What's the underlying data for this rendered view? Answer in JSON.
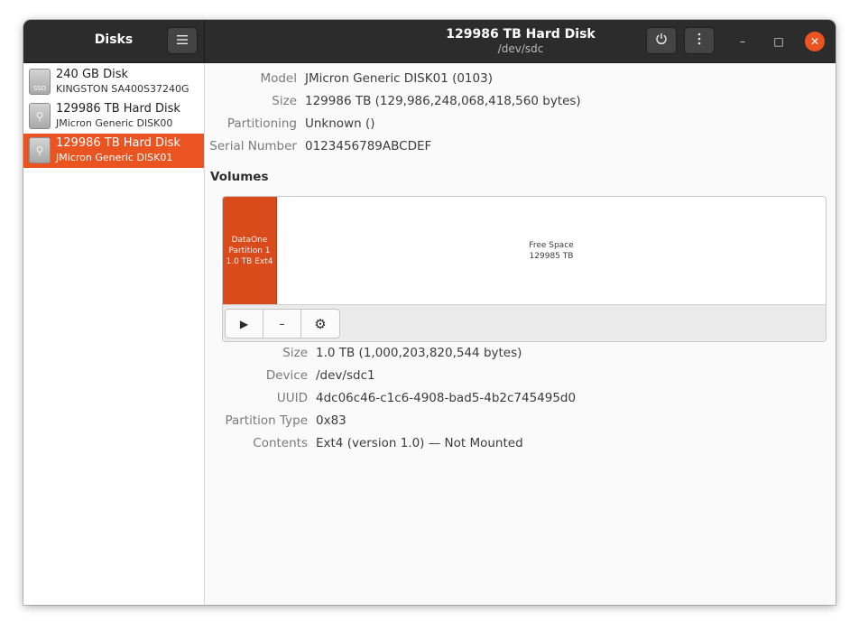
{
  "app": {
    "title": "Disks",
    "menu_icon": "hamburger-menu-icon"
  },
  "window": {
    "title": "129986 TB Hard Disk",
    "subtitle": "/dev/sdc",
    "power_icon": "power-icon",
    "more_icon": "vertical-dots-icon",
    "minimize_glyph": "–",
    "maximize_glyph": "□",
    "close_glyph": "✕"
  },
  "disks": [
    {
      "name": "240 GB Disk",
      "model": "KINGSTON SA400S37240G",
      "icon": "ssd-icon",
      "icon_text": "SSD",
      "selected": false
    },
    {
      "name": "129986 TB Hard Disk",
      "model": "JMicron Generic DISK00",
      "icon": "usb-drive-icon",
      "icon_text": "⚲",
      "selected": false
    },
    {
      "name": "129986 TB Hard Disk",
      "model": "JMicron Generic DISK01",
      "icon": "usb-drive-icon",
      "icon_text": "⚲",
      "selected": true
    }
  ],
  "drive_properties": [
    {
      "label": "Model",
      "value": "JMicron Generic DISK01 (0103)"
    },
    {
      "label": "Size",
      "value": "129986 TB (129,986,248,068,418,560 bytes)"
    },
    {
      "label": "Partitioning",
      "value": "Unknown ()"
    },
    {
      "label": "Serial Number",
      "value": "0123456789ABCDEF"
    }
  ],
  "volumes": {
    "heading": "Volumes",
    "partition": {
      "name": "DataOne",
      "number": "Partition 1",
      "info": "1.0 TB Ext4"
    },
    "free_space": {
      "label": "Free Space",
      "size": "129985 TB"
    },
    "toolbar": {
      "mount_glyph": "▶",
      "delete_glyph": "–",
      "settings_glyph": "⚙"
    }
  },
  "partition_properties": [
    {
      "label": "Size",
      "value": "1.0 TB (1,000,203,820,544 bytes)"
    },
    {
      "label": "Device",
      "value": "/dev/sdc1"
    },
    {
      "label": "UUID",
      "value": "4dc06c46-c1c6-4908-bad5-4b2c745495d0"
    },
    {
      "label": "Partition Type",
      "value": "0x83"
    },
    {
      "label": "Contents",
      "value": "Ext4 (version 1.0) — Not Mounted"
    }
  ],
  "colors": {
    "accent": "#e95420",
    "partition_fill": "#d94b1b",
    "headerbar": "#2c2c2c"
  }
}
